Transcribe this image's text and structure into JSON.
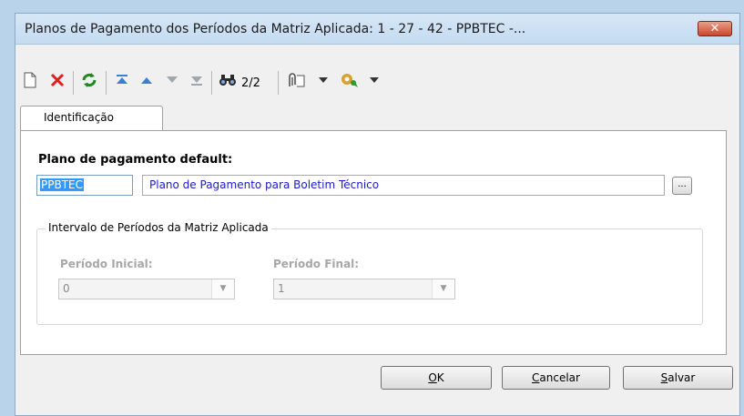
{
  "window": {
    "title": "Planos de Pagamento dos Períodos da Matriz Aplicada: 1 - 27 - 42 - PPBTEC -...",
    "close_label": "✕"
  },
  "toolbar": {
    "icons": [
      "new-document-icon",
      "delete-icon",
      "refresh-icon",
      "first-record-icon",
      "previous-record-icon",
      "next-record-icon",
      "last-record-icon",
      "find-icon",
      "attachment-icon",
      "dropdown-arrow-icon",
      "process-icon",
      "dropdown-arrow-icon"
    ],
    "record_position": "2/2"
  },
  "tabs": [
    {
      "label": "Identificação"
    }
  ],
  "form": {
    "plano_label": "Plano de pagamento default:",
    "plano_code": "PPBTEC",
    "plano_description": "Plano de Pagamento para Boletim Técnico",
    "lookup_label": "...",
    "group_title": "Intervalo de Períodos da Matriz Aplicada",
    "periodo_inicial_label": "Período Inicial:",
    "periodo_inicial_value": "0",
    "periodo_final_label": "Período Final:",
    "periodo_final_value": "1"
  },
  "buttons": {
    "ok_prefix": "O",
    "ok_ul": "K",
    "ok_suffix": "",
    "cancel_ul": "C",
    "cancel_rest": "ancelar",
    "save_ul": "S",
    "save_rest": "alvar"
  },
  "colors": {
    "link_text": "#1a1acc",
    "selection": "#3399ff"
  }
}
